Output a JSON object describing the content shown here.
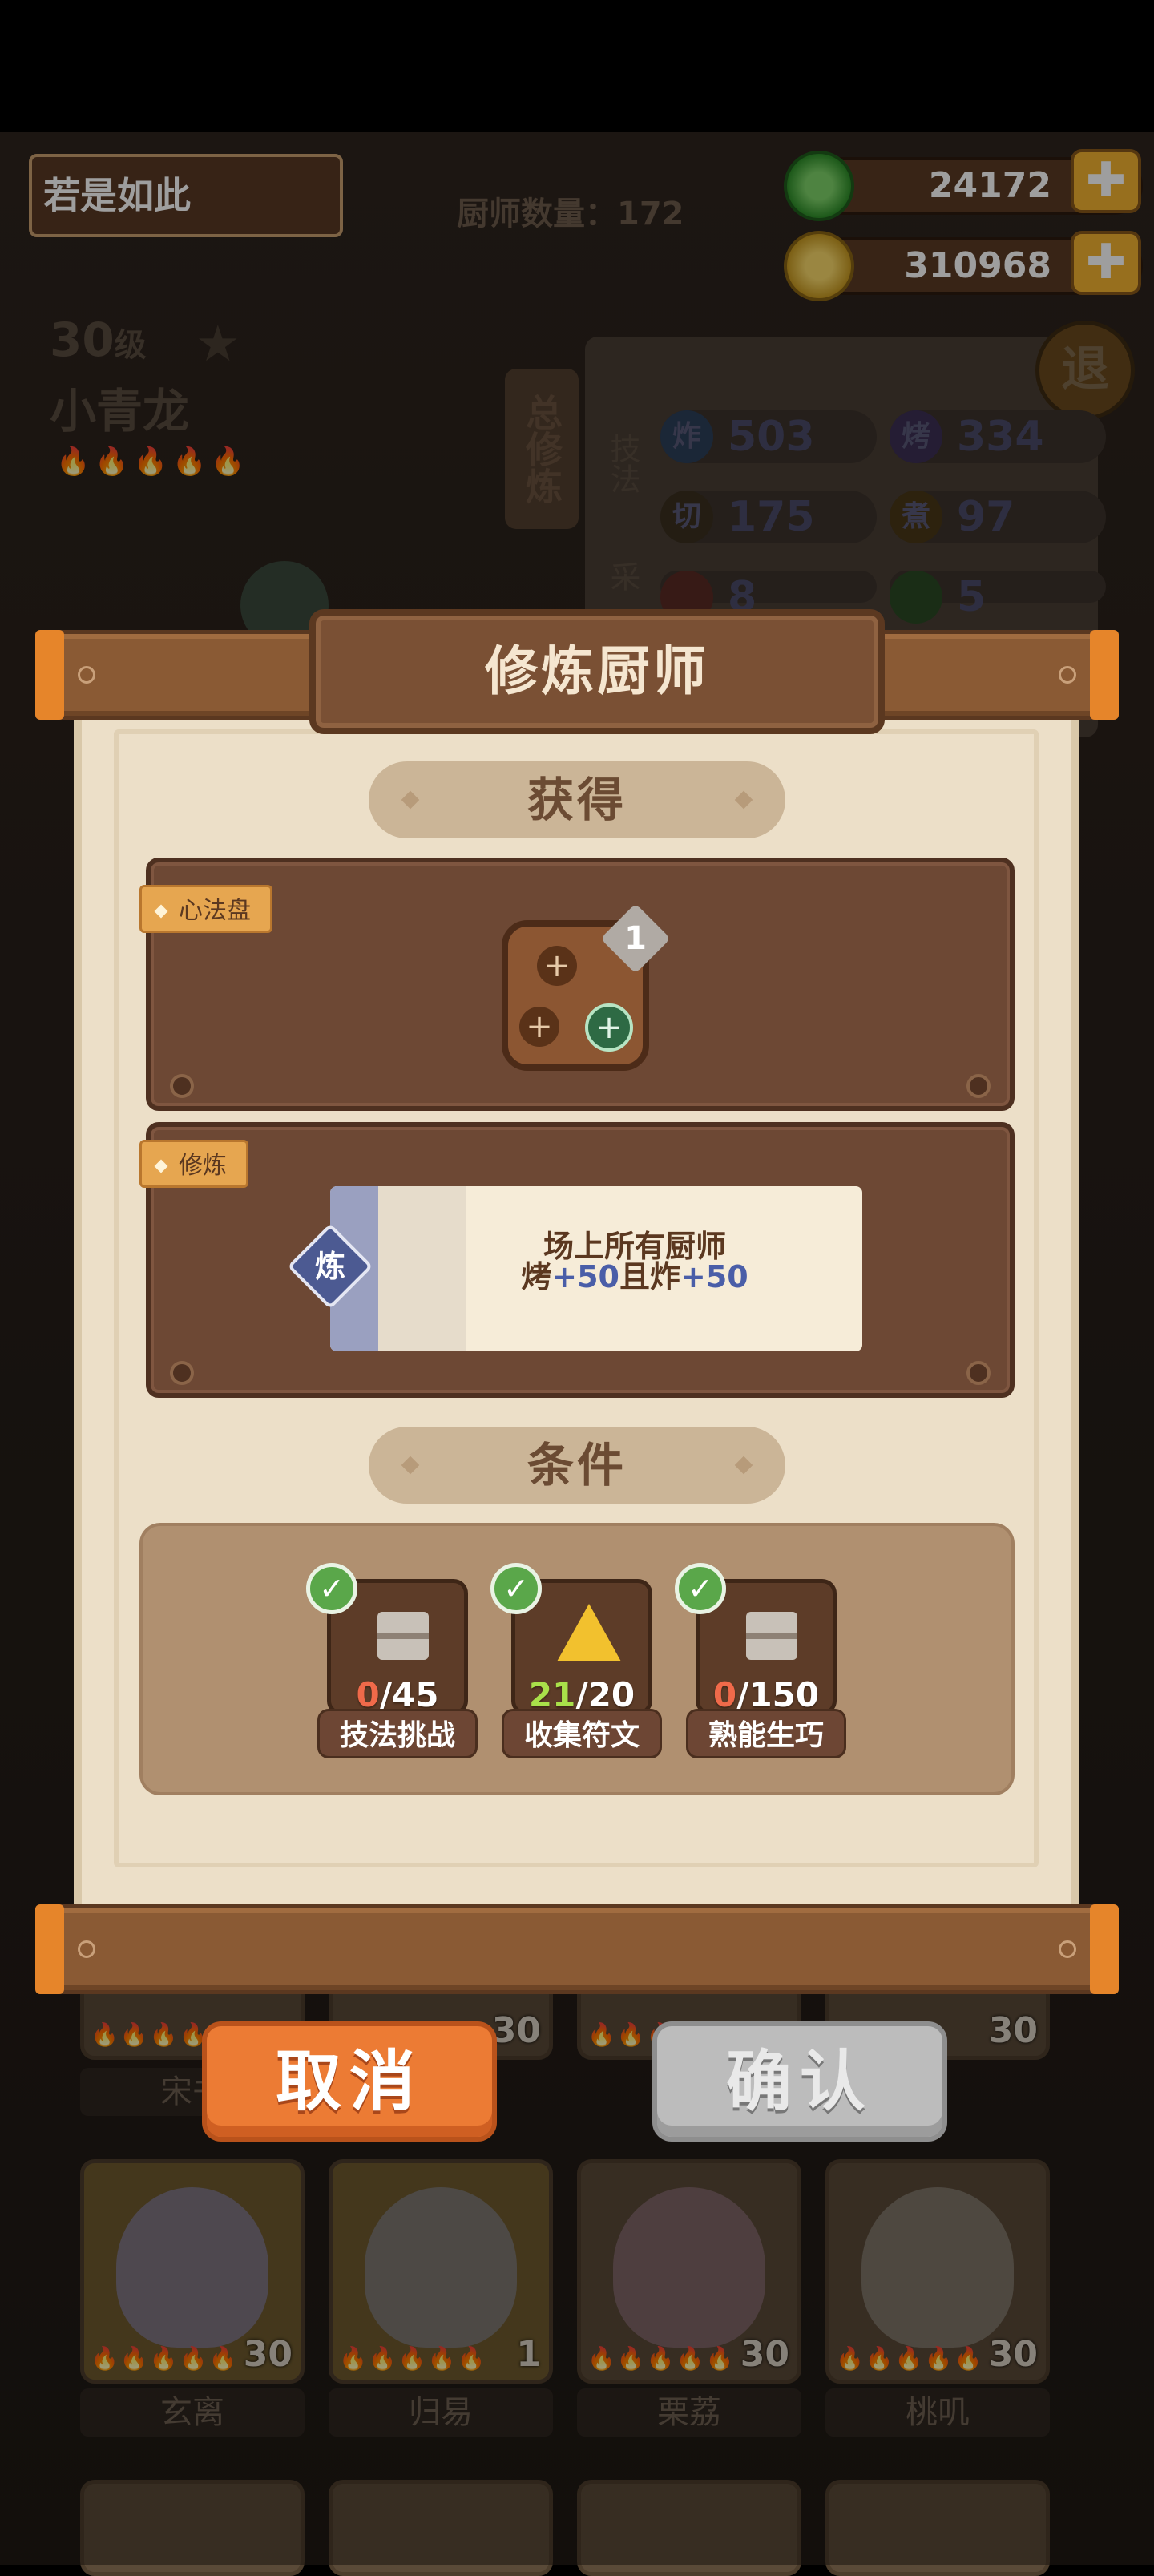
{
  "header": {
    "name_box": "若是如此",
    "chef_count_label": "厨师数量：172",
    "jade": "24172",
    "coins": "310968",
    "plus": "✚"
  },
  "background": {
    "level": "30",
    "level_unit": "级",
    "chef_name": "小青龙",
    "flames": "🔥🔥🔥🔥🔥",
    "side_tab": "总修炼",
    "section_label": "技法",
    "section_label_2": "采",
    "exit": "退",
    "stats": [
      {
        "icon": "炸",
        "value": "503"
      },
      {
        "icon": "烤",
        "value": "334"
      },
      {
        "icon": "切",
        "value": "175"
      },
      {
        "icon": "煮",
        "value": "97"
      },
      {
        "icon": "",
        "value": "8"
      },
      {
        "icon": "",
        "value": "5"
      }
    ],
    "cards_row1": [
      {
        "name": "宋书",
        "level": ""
      },
      {
        "name": "",
        "level": "30"
      },
      {
        "name": "",
        "level": ""
      },
      {
        "name": "",
        "level": "30"
      }
    ],
    "cards_row2": [
      {
        "name": "玄离",
        "level": "30"
      },
      {
        "name": "归易",
        "level": "1"
      },
      {
        "name": "栗荔",
        "level": "30"
      },
      {
        "name": "桃叽",
        "level": "30"
      }
    ]
  },
  "dialog": {
    "title": "修炼厨师",
    "obtain_label": "获得",
    "tag_xinfa": "心法盘",
    "tag_xiulian": "修炼",
    "icon_badge": "1",
    "lian_badge": "炼",
    "effect_line1": "场上所有厨师",
    "effect_p1": "烤",
    "effect_v1": "+50",
    "effect_p2": "且炸",
    "effect_v2": "+50",
    "condition_label": "条件",
    "conditions": [
      {
        "current": "0",
        "total": "/45",
        "label": "技法挑战",
        "icon": "scroll-icon"
      },
      {
        "current": "21",
        "total": "/20",
        "label": "收集符文",
        "icon": "rune-icon"
      },
      {
        "current": "0",
        "total": "/150",
        "label": "熟能生巧",
        "icon": "scroll-icon"
      }
    ],
    "check": "✓",
    "cancel": "取消",
    "confirm": "确认"
  }
}
